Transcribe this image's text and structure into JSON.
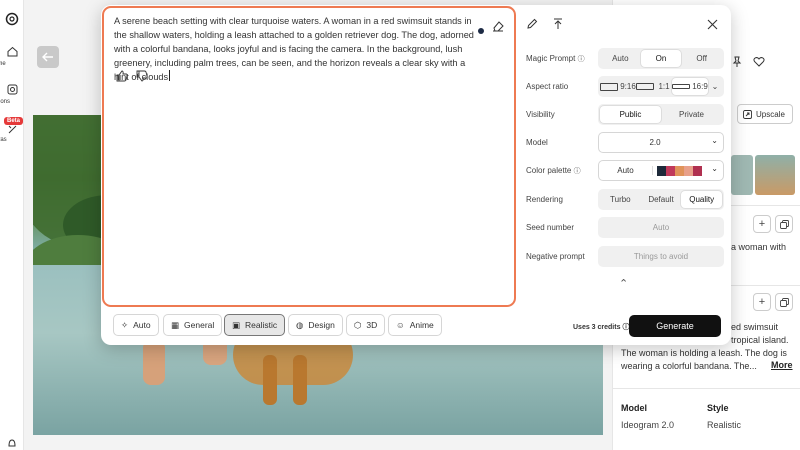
{
  "nav": {
    "items": [
      {
        "label": "ome",
        "icon": "home-icon"
      },
      {
        "label": "ations",
        "icon": "creations-icon"
      },
      {
        "label": "nvas",
        "icon": "canvas-icon"
      }
    ],
    "beta_badge": "Beta"
  },
  "prompt": {
    "text": "A serene beach setting with clear turquoise waters. A woman in a red swimsuit stands in the shallow waters, holding a leash attached to a golden retriever dog. The dog, adorned with a colorful bandana, looks joyful and is facing the camera. In the background, lush greenery, including palm trees, can be seen, and the horizon reveals a clear sky with a hint of clouds"
  },
  "styles": [
    {
      "label": "Auto",
      "icon": "sparkle-icon",
      "active": false
    },
    {
      "label": "General",
      "icon": "grid-icon",
      "active": false
    },
    {
      "label": "Realistic",
      "icon": "camera-icon",
      "active": true
    },
    {
      "label": "Design",
      "icon": "palette-icon",
      "active": false
    },
    {
      "label": "3D",
      "icon": "cube-icon",
      "active": false
    },
    {
      "label": "Anime",
      "icon": "anime-face-icon",
      "active": false
    }
  ],
  "settings": {
    "magic_prompt": {
      "label": "Magic Prompt",
      "options": [
        "Auto",
        "On",
        "Off"
      ],
      "selected": "On"
    },
    "aspect_ratio": {
      "label": "Aspect ratio",
      "options": [
        "9:16",
        "1:1",
        "16:9"
      ],
      "selected": "16:9"
    },
    "visibility": {
      "label": "Visibility",
      "options": [
        "Public",
        "Private"
      ],
      "selected": "Public"
    },
    "model": {
      "label": "Model",
      "value": "2.0"
    },
    "color_palette": {
      "label": "Color palette",
      "value": "Auto",
      "swatches": [
        "#1e2a3a",
        "#c0395a",
        "#e0935a",
        "#e8a08a",
        "#b03050"
      ]
    },
    "rendering": {
      "label": "Rendering",
      "options": [
        "Turbo",
        "Default",
        "Quality"
      ],
      "selected": "Quality"
    },
    "seed_number": {
      "label": "Seed number",
      "placeholder": "Auto"
    },
    "negative_prompt": {
      "label": "Negative prompt",
      "placeholder": "Things to avoid"
    }
  },
  "footer": {
    "credits": "Uses 3 credits",
    "generate_label": "Generate"
  },
  "details": {
    "upscale_label": "Upscale",
    "snippet1": "a woman with",
    "snippet2_line1": "ed swimsuit",
    "snippet2_line2": "tropical island.",
    "snippet2_line3": "The woman is holding a leash. The dog is",
    "snippet2_line4": "wearing a colorful bandana. The...",
    "more_label": "More",
    "model_heading": "Model",
    "model_value": "Ideogram 2.0",
    "style_heading": "Style",
    "style_value": "Realistic"
  },
  "colors": {
    "accent_border": "#ee7a52",
    "generate_bg": "#111111",
    "beta": "#e53a3a"
  }
}
